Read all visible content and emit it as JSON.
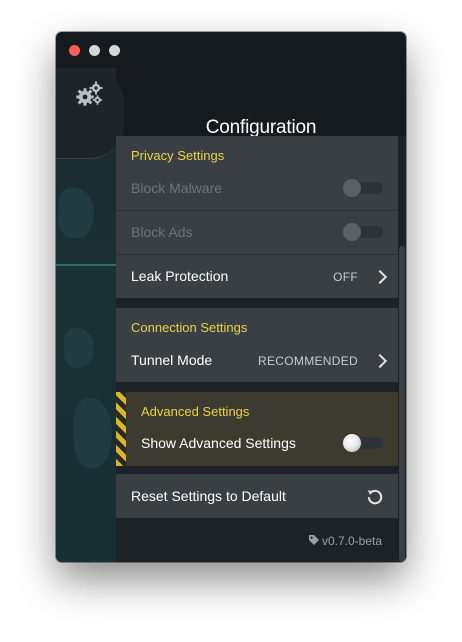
{
  "window": {
    "title": "Configuration"
  },
  "privacy": {
    "section_title": "Privacy Settings",
    "block_malware_label": "Block Malware",
    "block_malware_enabled": false,
    "block_ads_label": "Block Ads",
    "block_ads_enabled": false,
    "leak_protection_label": "Leak Protection",
    "leak_protection_value": "OFF"
  },
  "connection": {
    "section_title": "Connection Settings",
    "tunnel_mode_label": "Tunnel Mode",
    "tunnel_mode_value": "RECOMMENDED"
  },
  "advanced": {
    "section_title": "Advanced Settings",
    "show_advanced_label": "Show Advanced Settings",
    "show_advanced_enabled": false
  },
  "reset": {
    "label": "Reset Settings to Default"
  },
  "footer": {
    "version": "v0.7.0-beta"
  },
  "icons": {
    "settings": "gears-icon",
    "reset": "reset-icon",
    "version_tag": "tag-icon"
  },
  "colors": {
    "section_title": "#e8d44a",
    "close_button": "#fc5d57",
    "hazard_stripe": "#d9b52c"
  }
}
